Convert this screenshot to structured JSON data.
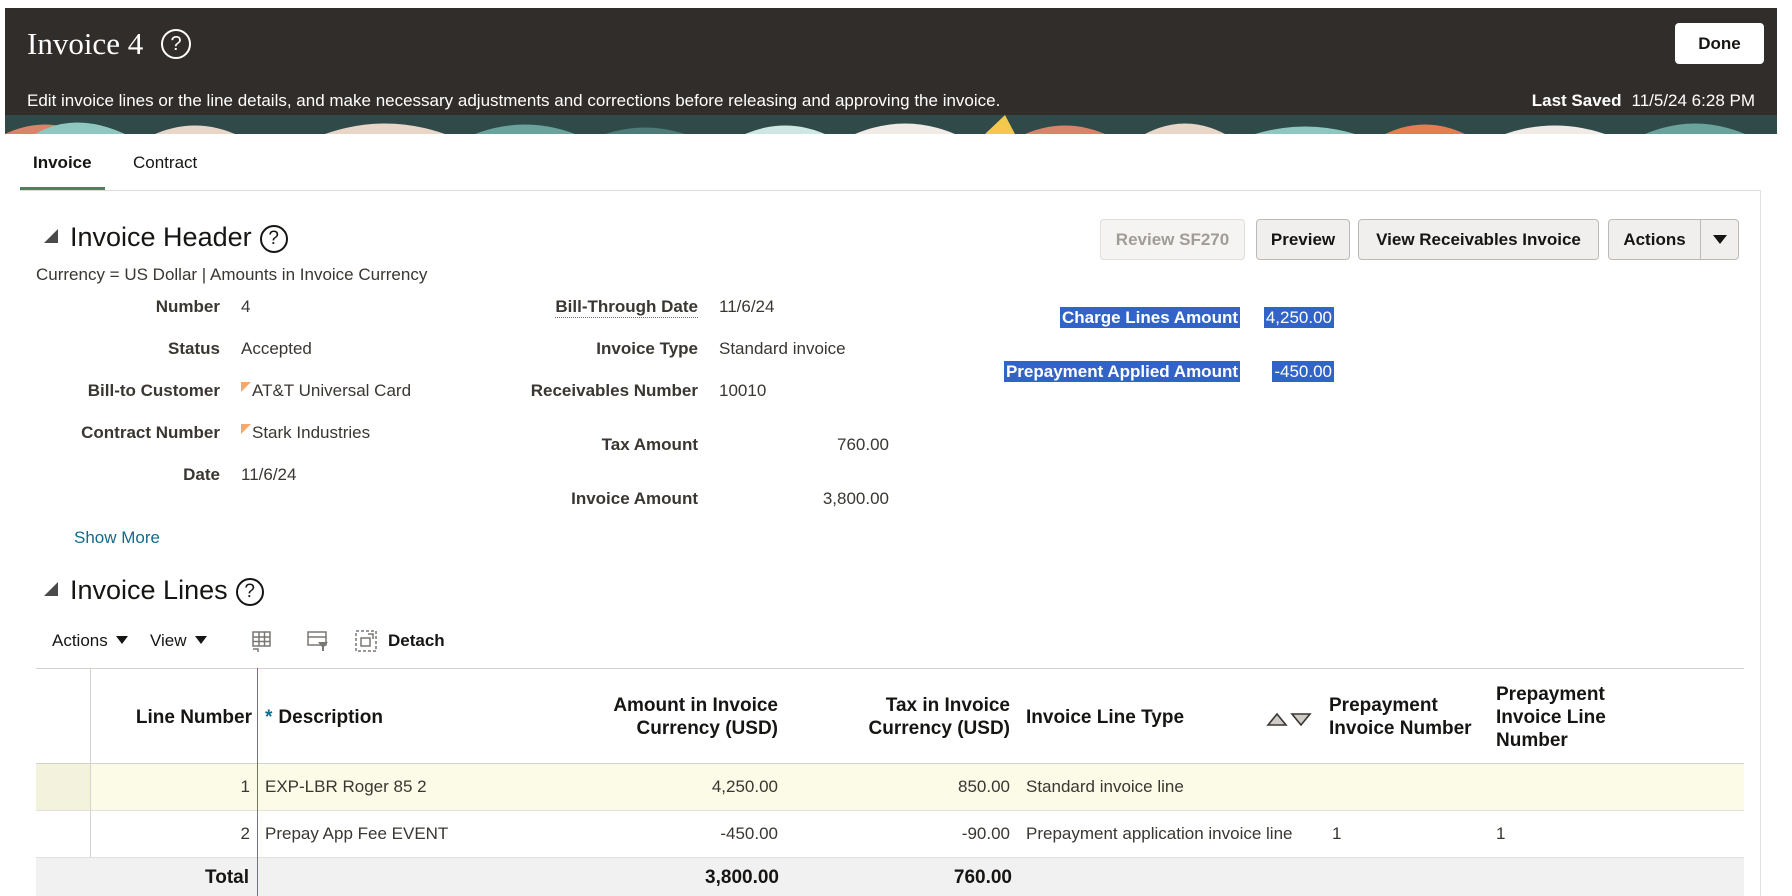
{
  "page": {
    "title": "Invoice 4",
    "help_glyph": "?",
    "description": "Edit invoice lines or the line details, and make necessary adjustments and corrections before releasing and approving the invoice.",
    "done_label": "Done",
    "last_saved_label": "Last Saved",
    "last_saved_value": "11/5/24 6:28 PM"
  },
  "tabs": [
    {
      "label": "Invoice",
      "active": true
    },
    {
      "label": "Contract",
      "active": false
    }
  ],
  "invoice_header": {
    "title": "Invoice Header",
    "currency_note": "Currency = US Dollar | Amounts in Invoice Currency",
    "buttons": {
      "review_sf270": "Review SF270",
      "preview": "Preview",
      "view_receivables": "View Receivables Invoice",
      "actions": "Actions"
    },
    "fields_left": [
      {
        "label": "Number",
        "value": "4"
      },
      {
        "label": "Status",
        "value": "Accepted"
      },
      {
        "label": "Bill-to Customer",
        "value": "AT&T Universal Card"
      },
      {
        "label": "Contract Number",
        "value": "Stark Industries"
      },
      {
        "label": "Date",
        "value": "11/6/24"
      }
    ],
    "fields_middle": [
      {
        "label": "Bill-Through Date",
        "value": "11/6/24"
      },
      {
        "label": "Invoice Type",
        "value": "Standard invoice"
      },
      {
        "label": "Receivables Number",
        "value": "10010"
      },
      {
        "label": "Tax Amount",
        "value": "760.00"
      },
      {
        "label": "Invoice Amount",
        "value": "3,800.00"
      }
    ],
    "fields_right": [
      {
        "label": "Charge Lines Amount",
        "value": "4,250.00"
      },
      {
        "label": "Prepayment Applied Amount",
        "value": "-450.00"
      }
    ],
    "show_more": "Show More"
  },
  "invoice_lines": {
    "title": "Invoice Lines",
    "toolbar": {
      "actions": "Actions",
      "view": "View",
      "detach": "Detach",
      "icons": [
        "freeze-columns-icon",
        "query-by-example-icon",
        "detach-icon"
      ]
    },
    "columns": {
      "line_number": "Line Number",
      "description_star": "*",
      "description": "Description",
      "amount_line1": "Amount in Invoice",
      "amount_line2": "Currency (USD)",
      "tax_line1": "Tax in Invoice",
      "tax_line2": "Currency (USD)",
      "line_type": "Invoice Line Type",
      "prepay_num_line1": "Prepayment",
      "prepay_num_line2": "Invoice Number",
      "prepay_line_line1": "Prepayment",
      "prepay_line_line2": "Invoice Line",
      "prepay_line_line3": "Number"
    },
    "rows": [
      {
        "line_number": "1",
        "description": "EXP-LBR Roger 85 2",
        "amount": "4,250.00",
        "tax": "850.00",
        "line_type": "Standard invoice line",
        "prepay_invoice_number": "",
        "prepay_line_number": ""
      },
      {
        "line_number": "2",
        "description": "Prepay App Fee EVENT",
        "amount": "-450.00",
        "tax": "-90.00",
        "line_type": "Prepayment application invoice line",
        "prepay_invoice_number": "1",
        "prepay_line_number": "1"
      }
    ],
    "total": {
      "label": "Total",
      "amount": "3,800.00",
      "tax": "760.00"
    }
  },
  "colors": {
    "header_band": "#312d2a",
    "active_tab_underline": "#4c825c",
    "selection_highlight": "#3264c8",
    "link": "#136a8c",
    "freeze_line": "#1e90c8",
    "selected_row": "#fbfbe8"
  }
}
